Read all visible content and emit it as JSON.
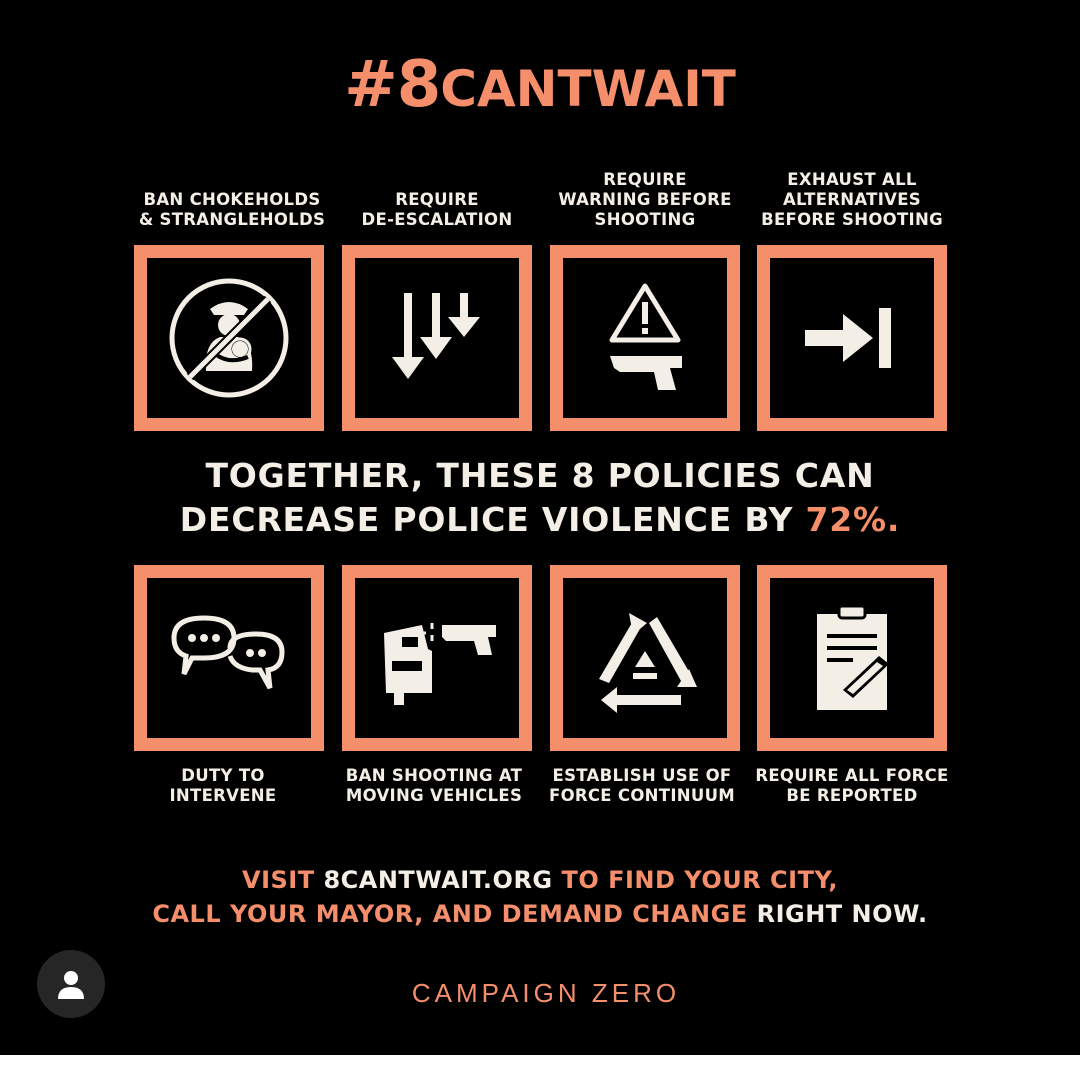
{
  "title": {
    "hash": "#8",
    "rest": "CANTWAIT"
  },
  "top_policies": [
    {
      "label": "BAN CHOKEHOLDS\n& STRANGLEHOLDS",
      "icon": "no-chokehold-icon"
    },
    {
      "label": "REQUIRE\nDE-ESCALATION",
      "icon": "down-arrows-icon"
    },
    {
      "label": "REQUIRE\nWARNING BEFORE\nSHOOTING",
      "icon": "warning-gun-icon"
    },
    {
      "label": "EXHAUST ALL\nALTERNATIVES\nBEFORE SHOOTING",
      "icon": "arrow-to-bar-icon"
    }
  ],
  "headline": {
    "line1": "TOGETHER, THESE 8 POLICIES CAN",
    "line2_prefix": "DECREASE POLICE VIOLENCE BY ",
    "line2_value": "72%."
  },
  "bottom_policies": [
    {
      "label": "DUTY TO\nINTERVENE",
      "icon": "speech-bubbles-icon"
    },
    {
      "label": "BAN SHOOTING AT\nMOVING VEHICLES",
      "icon": "car-gun-icon"
    },
    {
      "label": "ESTABLISH USE OF\nFORCE CONTINUUM",
      "icon": "triangle-arrows-icon"
    },
    {
      "label": "REQUIRE ALL FORCE\nBE REPORTED",
      "icon": "clipboard-icon"
    }
  ],
  "cta": {
    "line1_a": "VISIT ",
    "line1_b": "8CANTWAIT.ORG",
    "line1_c": " TO FIND YOUR CITY,",
    "line2_a": "CALL YOUR MAYOR, AND DEMAND CHANGE ",
    "line2_b": "RIGHT NOW."
  },
  "footer": "CAMPAIGN ZERO",
  "colors": {
    "accent": "#f48e6b",
    "text": "#f3efe6",
    "background": "#000000"
  },
  "avatar_icon": "user-icon"
}
